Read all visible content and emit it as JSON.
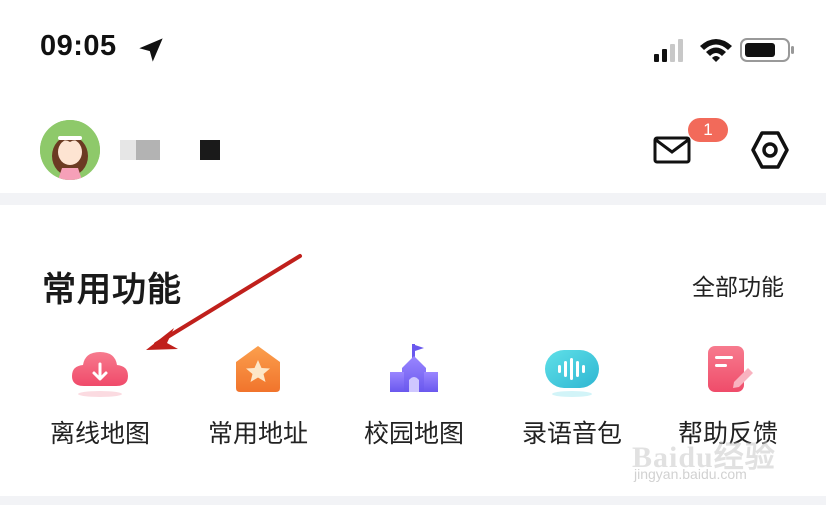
{
  "status_bar": {
    "time": "09:05",
    "icons": [
      "location-arrow-icon",
      "cellular-signal-icon",
      "wifi-icon",
      "battery-icon"
    ]
  },
  "profile": {
    "avatar_icon": "cartoon-girl-avatar",
    "mail_icon": "mail-icon",
    "mail_badge": "1",
    "settings_icon": "settings-icon"
  },
  "section": {
    "title": "常用功能",
    "all_link": "全部功能"
  },
  "features": [
    {
      "label": "离线地图",
      "icon": "cloud-download-icon",
      "color": "#f0607a"
    },
    {
      "label": "常用地址",
      "icon": "home-star-icon",
      "color": "#f58a3c"
    },
    {
      "label": "校园地图",
      "icon": "school-building-icon",
      "color": "#7b6cf6"
    },
    {
      "label": "录语音包",
      "icon": "voice-wave-icon",
      "color": "#3cc8d8"
    },
    {
      "label": "帮助反馈",
      "icon": "edit-note-icon",
      "color": "#f0607a"
    }
  ],
  "annotation": {
    "arrow_color": "#c0201c"
  },
  "watermark": {
    "brand": "Baidu经验",
    "url": "jingyan.baidu.com"
  },
  "colors": {
    "badge": "#f26a5a",
    "divider": "#f2f3f6"
  }
}
